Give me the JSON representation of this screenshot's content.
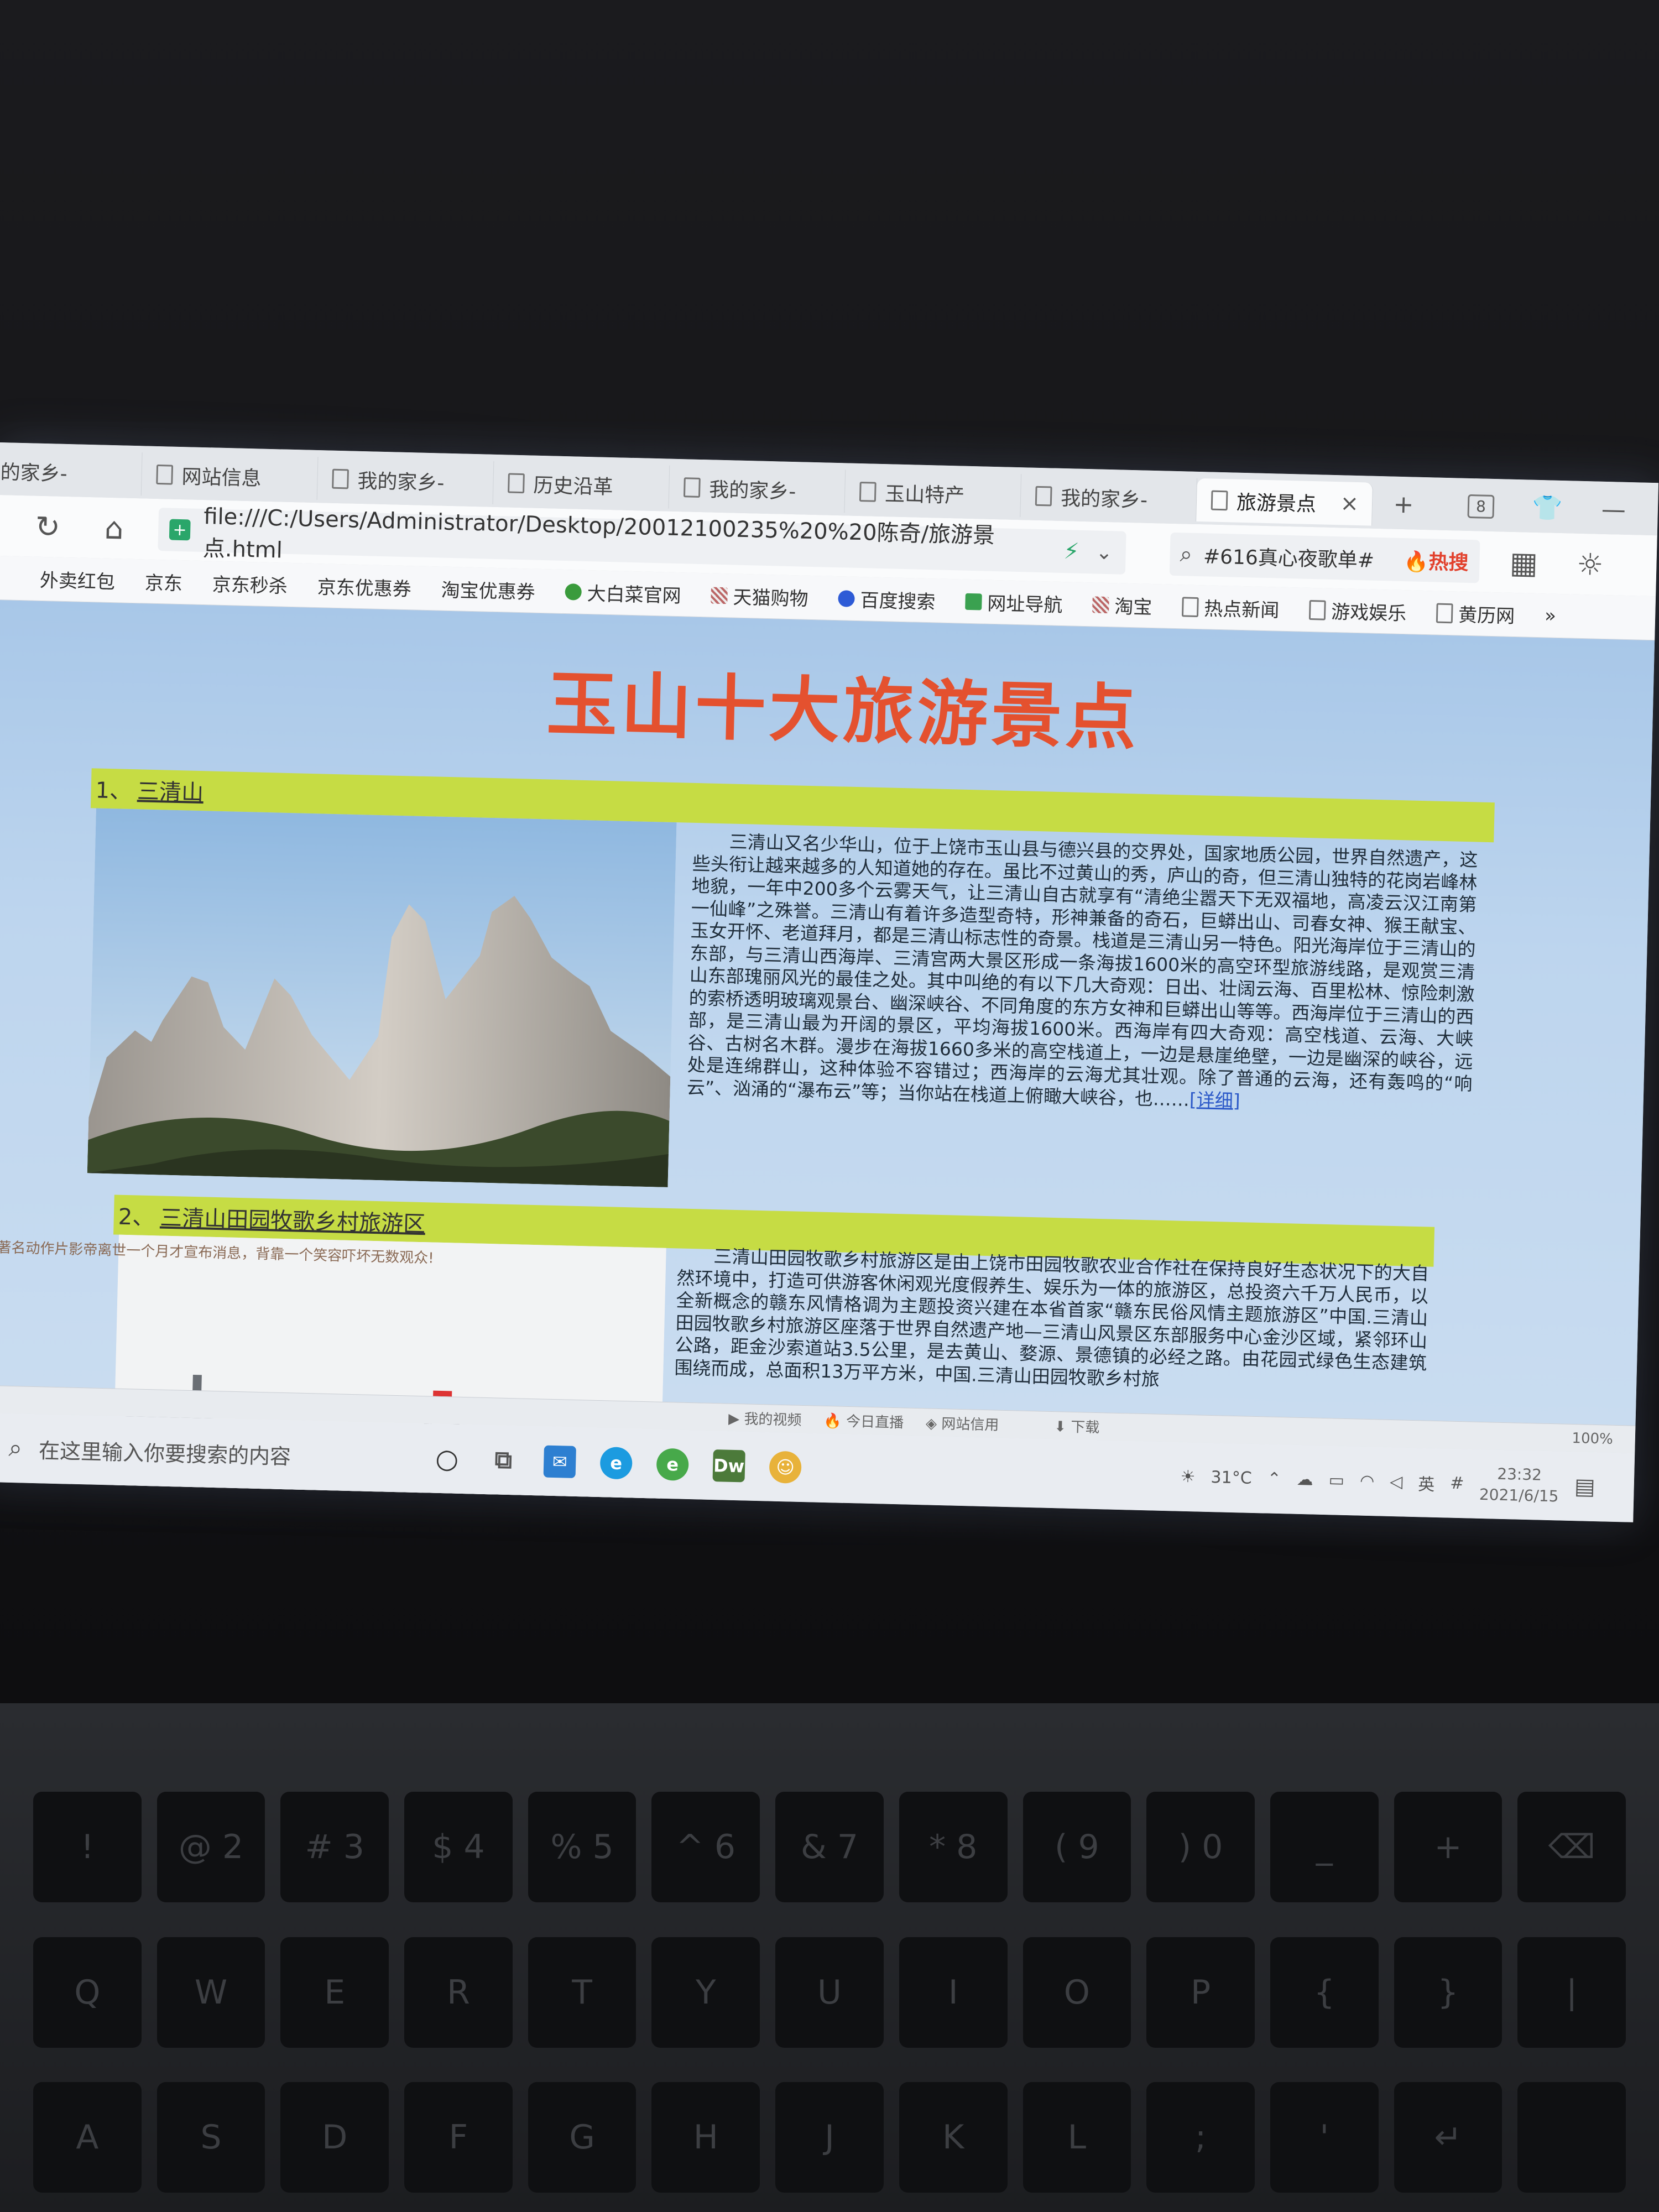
{
  "tabs": [
    {
      "label": "我的家乡-",
      "active": false
    },
    {
      "label": "网站信息",
      "active": false
    },
    {
      "label": "我的家乡-",
      "active": false
    },
    {
      "label": "历史沿革",
      "active": false
    },
    {
      "label": "我的家乡-",
      "active": false
    },
    {
      "label": "玉山特产",
      "active": false
    },
    {
      "label": "我的家乡-",
      "active": false
    },
    {
      "label": "旅游景点",
      "active": true
    }
  ],
  "window": {
    "tab_count": "8"
  },
  "address": {
    "url": "file:///C:/Users/Administrator/Desktop/20012100235%20%20陈奇/旅游景点.html"
  },
  "search": {
    "text": "#616真心夜歌单#",
    "hot_label": "热搜"
  },
  "bookmarks": [
    {
      "label": "外卖红包",
      "icon": "none"
    },
    {
      "label": "京东",
      "icon": "none"
    },
    {
      "label": "京东秒杀",
      "icon": "none"
    },
    {
      "label": "京东优惠券",
      "icon": "none"
    },
    {
      "label": "淘宝优惠券",
      "icon": "none"
    },
    {
      "label": "大白菜官网",
      "icon": "cabbage-icon"
    },
    {
      "label": "天猫购物",
      "icon": "tmall-icon"
    },
    {
      "label": "百度搜索",
      "icon": "baidu-icon"
    },
    {
      "label": "网址导航",
      "icon": "home-icon"
    },
    {
      "label": "淘宝",
      "icon": "taobao-icon"
    },
    {
      "label": "热点新闻",
      "icon": "doc-icon"
    },
    {
      "label": "游戏娱乐",
      "icon": "doc-icon"
    },
    {
      "label": "黄历网",
      "icon": "doc-icon"
    }
  ],
  "bookmarks_more": "»",
  "page": {
    "title": "玉山十大旅游景点",
    "sections": [
      {
        "number": "1、",
        "name": "三清山",
        "text": "三清山又名少华山，位于上饶市玉山县与德兴县的交界处，国家地质公园，世界自然遗产，这些头衔让越来越多的人知道她的存在。虽比不过黄山的秀，庐山的奇，但三清山独特的花岗岩峰林地貌，一年中200多个云雾天气，让三清山自古就享有“清绝尘嚣天下无双福地，高凌云汉江南第一仙峰”之殊誉。三清山有着许多造型奇特，形神兼备的奇石，巨蟒出山、司春女神、猴王献宝、玉女开怀、老道拜月，都是三清山标志性的奇景。栈道是三清山另一特色。阳光海岸位于三清山的东部，与三清山西海岸、三清宫两大景区形成一条海拔1600米的高空环型旅游线路，是观赏三清山东部瑰丽风光的最佳之处。其中叫绝的有以下几大奇观：日出、壮阔云海、百里松林、惊险刺激的索桥透明玻璃观景台、幽深峡谷、不同角度的东方女神和巨蟒出山等等。西海岸位于三清山的西部，是三清山最为开阔的景区，平均海拔1600米。西海岸有四大奇观：高空栈道、云海、大峡谷、古树名木群。漫步在海拔1660多米的高空栈道上，一边是悬崖绝壁，一边是幽深的峡谷，远处是连绵群山，这种体验不容错过；西海岸的云海尤其壮观。除了普通的云海，还有轰鸣的“响云”、汹涌的“瀑布云”等；当你站在栈道上俯瞰大峡谷，也……",
        "more": "[详细]"
      },
      {
        "number": "2、",
        "name": "三清山田园牧歌乡村旅游区",
        "text": "三清山田园牧歌乡村旅游区是由上饶市田园牧歌农业合作社在保持良好生态状况下的大自然环境中，打造可供游客休闲观光度假养生、娱乐为一体的旅游区，总投资六千万人民币，以全新概念的赣东风情格调为主题投资兴建在本省首家“赣东民俗风情主题旅游区”中国.三清山田园牧歌乡村旅游区座落于世界自然遗产地—三清山风景区东部服务中心金沙区域，紧邻环山公路，距金沙索道站3.5公里，是去黄山、婺源、景德镇的必经之路。由花园式绿色生态建筑围绕而成，总面积13万平方米，中国.三清山田园牧歌乡村旅",
        "more": ""
      }
    ]
  },
  "notice": "著名动作片影帝离世一个月才宣布消息，背靠一个笑容吓坏无数观众!",
  "statusbar": [
    "我的视频",
    "今日直播",
    "网站信用",
    "下载",
    "100%"
  ],
  "taskbar": {
    "search_placeholder": "在这里输入你要搜索的内容",
    "weather": "31°C",
    "ime": "英",
    "time": "23:32",
    "date": "2021/6/15",
    "dw_label": "Dw"
  },
  "keyboard": {
    "rows": [
      [
        "!",
        "@ 2",
        "# 3",
        "$ 4",
        "% 5",
        "^ 6",
        "& 7",
        "* 8",
        "( 9",
        ") 0",
        "_",
        "+",
        "⌫"
      ],
      [
        "Q",
        "W",
        "E",
        "R",
        "T",
        "Y",
        "U",
        "I",
        "O",
        "P",
        "{",
        "}",
        "|"
      ],
      [
        "A",
        "S",
        "D",
        "F",
        "G",
        "H",
        "J",
        "K",
        "L",
        ";",
        "'",
        "↵",
        ""
      ]
    ]
  },
  "colors": {
    "title": "#e4512f",
    "section_bar": "#c6dc44",
    "page_bg": "#b6d1ec",
    "link": "#2b58c8"
  }
}
